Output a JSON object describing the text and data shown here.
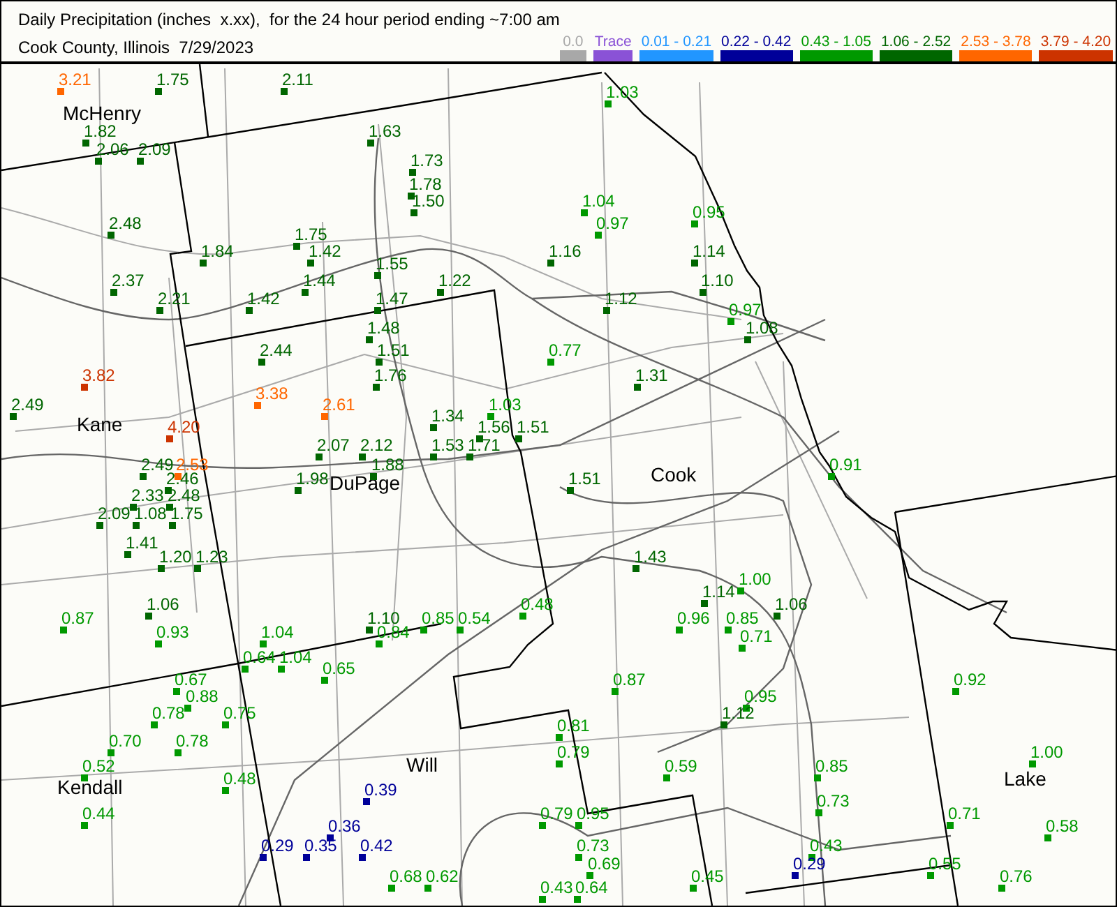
{
  "title": "Daily Precipitation (inches  x.xx),  for the 24 hour period ending ~7:00 am",
  "subtitle": "Cook County, Illinois  7/29/2023",
  "legend": [
    {
      "label": "0.0",
      "color": "#a8a8a8"
    },
    {
      "label": "Trace",
      "color": "#8a52d6"
    },
    {
      "label": "0.01 - 0.21",
      "color": "#2196ff"
    },
    {
      "label": "0.22 - 0.42",
      "color": "#000099"
    },
    {
      "label": "0.43 - 1.05",
      "color": "#009900"
    },
    {
      "label": "1.06 - 2.52",
      "color": "#006600"
    },
    {
      "label": "2.53 - 3.78",
      "color": "#ff6600"
    },
    {
      "label": "3.79 - 4.20",
      "color": "#cc3300"
    }
  ],
  "counties": [
    {
      "name": "McHenry"
    },
    {
      "name": "Kane"
    },
    {
      "name": "DuPage"
    },
    {
      "name": "Cook"
    },
    {
      "name": "Will"
    },
    {
      "name": "Kendall"
    },
    {
      "name": "Lake"
    }
  ],
  "stations": [
    {
      "value": "3.21",
      "color": "#ff6600"
    },
    {
      "value": "1.75",
      "color": "#006600"
    },
    {
      "value": "2.11",
      "color": "#006600"
    },
    {
      "value": "1.03",
      "color": "#009900"
    },
    {
      "value": "1.82",
      "color": "#006600"
    },
    {
      "value": "1.63",
      "color": "#006600"
    },
    {
      "value": "2.06",
      "color": "#006600"
    },
    {
      "value": "2.09",
      "color": "#006600"
    },
    {
      "value": "1.73",
      "color": "#006600"
    },
    {
      "value": "1.78",
      "color": "#006600"
    },
    {
      "value": "1.50",
      "color": "#006600"
    },
    {
      "value": "1.04",
      "color": "#009900"
    },
    {
      "value": "0.95",
      "color": "#009900"
    },
    {
      "value": "2.48",
      "color": "#006600"
    },
    {
      "value": "0.97",
      "color": "#009900"
    },
    {
      "value": "1.75",
      "color": "#006600"
    },
    {
      "value": "1.84",
      "color": "#006600"
    },
    {
      "value": "1.42",
      "color": "#006600"
    },
    {
      "value": "1.16",
      "color": "#006600"
    },
    {
      "value": "1.14",
      "color": "#006600"
    },
    {
      "value": "1.55",
      "color": "#006600"
    },
    {
      "value": "2.37",
      "color": "#006600"
    },
    {
      "value": "1.44",
      "color": "#006600"
    },
    {
      "value": "1.22",
      "color": "#006600"
    },
    {
      "value": "1.10",
      "color": "#006600"
    },
    {
      "value": "2.21",
      "color": "#006600"
    },
    {
      "value": "1.42",
      "color": "#006600"
    },
    {
      "value": "1.47",
      "color": "#006600"
    },
    {
      "value": "1.12",
      "color": "#006600"
    },
    {
      "value": "0.97",
      "color": "#009900"
    },
    {
      "value": "1.48",
      "color": "#006600"
    },
    {
      "value": "1.08",
      "color": "#006600"
    },
    {
      "value": "2.44",
      "color": "#006600"
    },
    {
      "value": "1.51",
      "color": "#006600"
    },
    {
      "value": "0.77",
      "color": "#009900"
    },
    {
      "value": "3.82",
      "color": "#cc3300"
    },
    {
      "value": "1.76",
      "color": "#006600"
    },
    {
      "value": "1.31",
      "color": "#006600"
    },
    {
      "value": "3.38",
      "color": "#ff6600"
    },
    {
      "value": "2.49",
      "color": "#006600"
    },
    {
      "value": "2.61",
      "color": "#ff6600"
    },
    {
      "value": "1.03",
      "color": "#009900"
    },
    {
      "value": "1.34",
      "color": "#006600"
    },
    {
      "value": "4.20",
      "color": "#cc3300"
    },
    {
      "value": "1.56",
      "color": "#006600"
    },
    {
      "value": "1.51",
      "color": "#006600"
    },
    {
      "value": "2.07",
      "color": "#006600"
    },
    {
      "value": "2.12",
      "color": "#006600"
    },
    {
      "value": "1.53",
      "color": "#006600"
    },
    {
      "value": "1.71",
      "color": "#006600"
    },
    {
      "value": "2.49",
      "color": "#006600"
    },
    {
      "value": "2.53",
      "color": "#ff6600"
    },
    {
      "value": "1.88",
      "color": "#006600"
    },
    {
      "value": "0.91",
      "color": "#009900"
    },
    {
      "value": "2.46",
      "color": "#006600"
    },
    {
      "value": "1.98",
      "color": "#006600"
    },
    {
      "value": "1.51",
      "color": "#006600"
    },
    {
      "value": "2.33",
      "color": "#006600"
    },
    {
      "value": "2.48",
      "color": "#006600"
    },
    {
      "value": "2.09",
      "color": "#006600"
    },
    {
      "value": "1.08",
      "color": "#006600"
    },
    {
      "value": "1.75",
      "color": "#006600"
    },
    {
      "value": "1.41",
      "color": "#006600"
    },
    {
      "value": "1.20",
      "color": "#006600"
    },
    {
      "value": "1.23",
      "color": "#006600"
    },
    {
      "value": "1.43",
      "color": "#006600"
    },
    {
      "value": "1.00",
      "color": "#009900"
    },
    {
      "value": "1.14",
      "color": "#006600"
    },
    {
      "value": "1.06",
      "color": "#006600"
    },
    {
      "value": "0.48",
      "color": "#009900"
    },
    {
      "value": "1.06",
      "color": "#006600"
    },
    {
      "value": "0.87",
      "color": "#009900"
    },
    {
      "value": "1.10",
      "color": "#006600"
    },
    {
      "value": "0.85",
      "color": "#009900"
    },
    {
      "value": "0.54",
      "color": "#009900"
    },
    {
      "value": "0.96",
      "color": "#009900"
    },
    {
      "value": "0.85",
      "color": "#009900"
    },
    {
      "value": "0.93",
      "color": "#009900"
    },
    {
      "value": "1.04",
      "color": "#009900"
    },
    {
      "value": "0.84",
      "color": "#009900"
    },
    {
      "value": "0.71",
      "color": "#009900"
    },
    {
      "value": "0.64",
      "color": "#009900"
    },
    {
      "value": "1.04",
      "color": "#009900"
    },
    {
      "value": "0.65",
      "color": "#009900"
    },
    {
      "value": "0.67",
      "color": "#009900"
    },
    {
      "value": "0.87",
      "color": "#009900"
    },
    {
      "value": "0.92",
      "color": "#009900"
    },
    {
      "value": "0.88",
      "color": "#009900"
    },
    {
      "value": "0.95",
      "color": "#009900"
    },
    {
      "value": "0.78",
      "color": "#009900"
    },
    {
      "value": "0.75",
      "color": "#009900"
    },
    {
      "value": "1.12",
      "color": "#006600"
    },
    {
      "value": "0.81",
      "color": "#009900"
    },
    {
      "value": "0.70",
      "color": "#009900"
    },
    {
      "value": "0.78",
      "color": "#009900"
    },
    {
      "value": "0.79",
      "color": "#009900"
    },
    {
      "value": "1.00",
      "color": "#009900"
    },
    {
      "value": "0.52",
      "color": "#009900"
    },
    {
      "value": "0.59",
      "color": "#009900"
    },
    {
      "value": "0.85",
      "color": "#009900"
    },
    {
      "value": "0.48",
      "color": "#009900"
    },
    {
      "value": "0.39",
      "color": "#000099"
    },
    {
      "value": "0.73",
      "color": "#009900"
    },
    {
      "value": "0.44",
      "color": "#009900"
    },
    {
      "value": "0.79",
      "color": "#009900"
    },
    {
      "value": "0.95",
      "color": "#009900"
    },
    {
      "value": "0.71",
      "color": "#009900"
    },
    {
      "value": "0.36",
      "color": "#000099"
    },
    {
      "value": "0.58",
      "color": "#009900"
    },
    {
      "value": "0.29",
      "color": "#000099"
    },
    {
      "value": "0.35",
      "color": "#000099"
    },
    {
      "value": "0.42",
      "color": "#000099"
    },
    {
      "value": "0.73",
      "color": "#009900"
    },
    {
      "value": "0.43",
      "color": "#009900"
    },
    {
      "value": "0.69",
      "color": "#009900"
    },
    {
      "value": "0.29",
      "color": "#000099"
    },
    {
      "value": "0.55",
      "color": "#009900"
    },
    {
      "value": "0.68",
      "color": "#009900"
    },
    {
      "value": "0.62",
      "color": "#009900"
    },
    {
      "value": "0.45",
      "color": "#009900"
    },
    {
      "value": "0.76",
      "color": "#009900"
    },
    {
      "value": "0.43",
      "color": "#009900"
    },
    {
      "value": "0.64",
      "color": "#009900"
    }
  ]
}
